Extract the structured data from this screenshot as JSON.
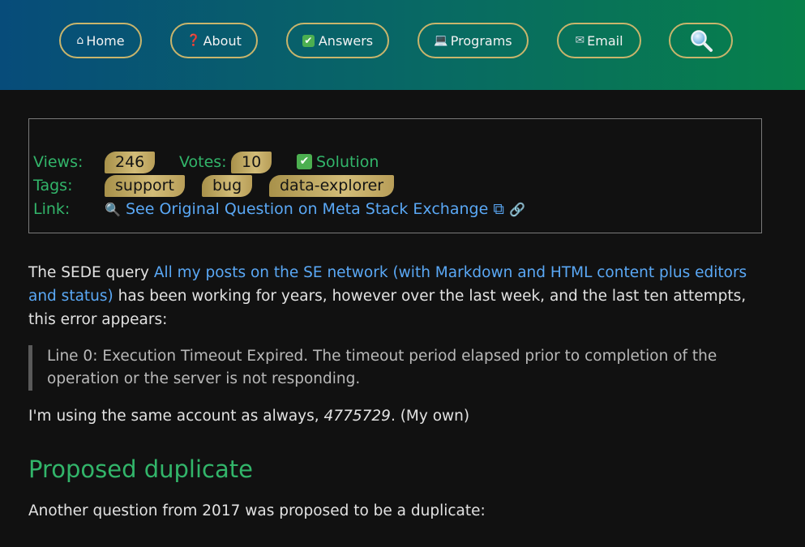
{
  "nav": {
    "home": {
      "icon": "⌂",
      "label": "Home"
    },
    "about": {
      "icon": "❓",
      "label": "About"
    },
    "answers": {
      "icon": "✔",
      "label": "Answers"
    },
    "programs": {
      "icon": "💻",
      "label": "Programs"
    },
    "email": {
      "icon": "✉",
      "label": "Email"
    },
    "search": {
      "icon": "search-icon"
    }
  },
  "meta": {
    "views_label": "Views:",
    "views": "246",
    "votes_label": "Votes:",
    "votes": "10",
    "solution_icon": "✔",
    "solution": "Solution",
    "tags_label": "Tags:",
    "tags": [
      "support",
      "bug",
      "data-explorer"
    ],
    "link_label": "Link:",
    "link_icon": "🔍",
    "link_text": "See Original Question on Meta Stack Exchange",
    "external_icon": "⧉",
    "chain_icon": "🔗"
  },
  "body": {
    "p1_start": "The SEDE query ",
    "p1_link": "All my posts on the SE network (with Markdown and HTML content plus editors and status)",
    "p1_end": " has been working for years, however over the last week, and the last ten attempts, this error appears:",
    "quote": "Line 0: Execution Timeout Expired. The timeout period elapsed prior to completion of the operation or the server is not responding.",
    "p2_start": "I'm using the same account as always, ",
    "p2_id": "4775729",
    "p2_end": ". (My own)",
    "heading": "Proposed duplicate",
    "p3": "Another question from 2017 was proposed to be a duplicate:"
  },
  "colors": {
    "accent_green": "#32b56a",
    "link_blue": "#5aa8f5",
    "pill_gold": "#c9b56c"
  }
}
